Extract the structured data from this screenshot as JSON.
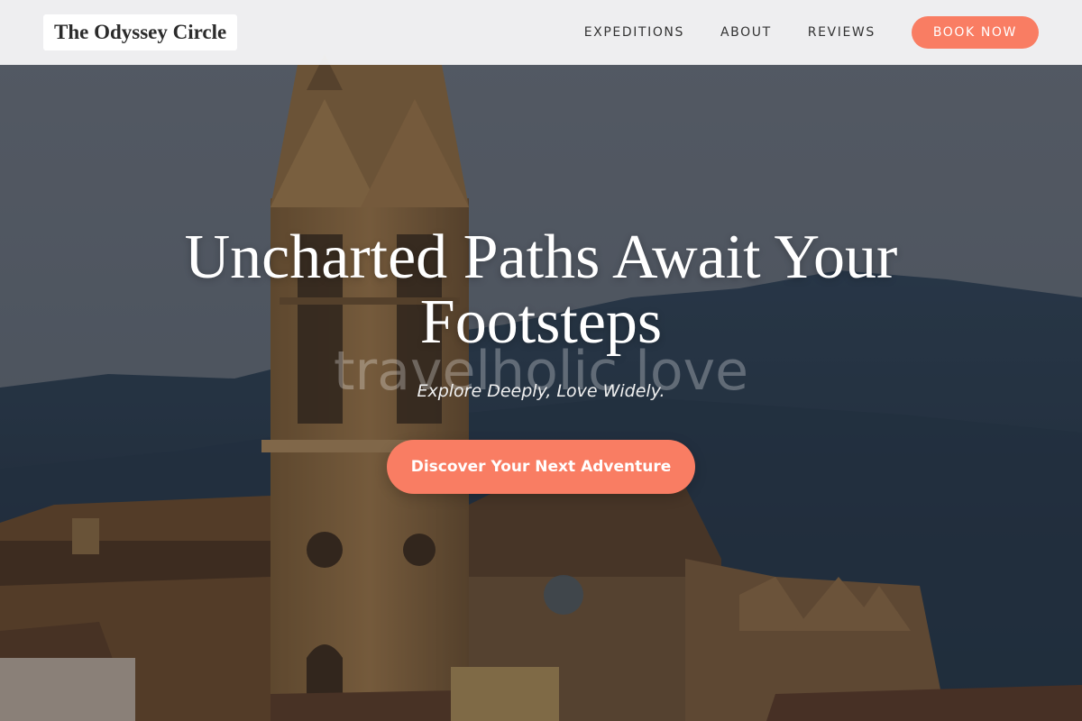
{
  "header": {
    "brand": "The Odyssey Circle",
    "nav": {
      "expeditions": "EXPEDITIONS",
      "about": "ABOUT",
      "reviews": "REVIEWS"
    },
    "book_button": "BOOK NOW"
  },
  "hero": {
    "title": "Uncharted Paths Await Your Footsteps",
    "watermark": "travelholic love",
    "subtitle": "Explore Deeply, Love Widely.",
    "cta_button": "Discover Your Next Adventure",
    "background_image": "church-bell-tower-with-mountains"
  },
  "colors": {
    "accent": "#f97d63",
    "header_bg": "#f5f5f6",
    "nav_text": "#333333",
    "title_text": "#ffffff"
  }
}
